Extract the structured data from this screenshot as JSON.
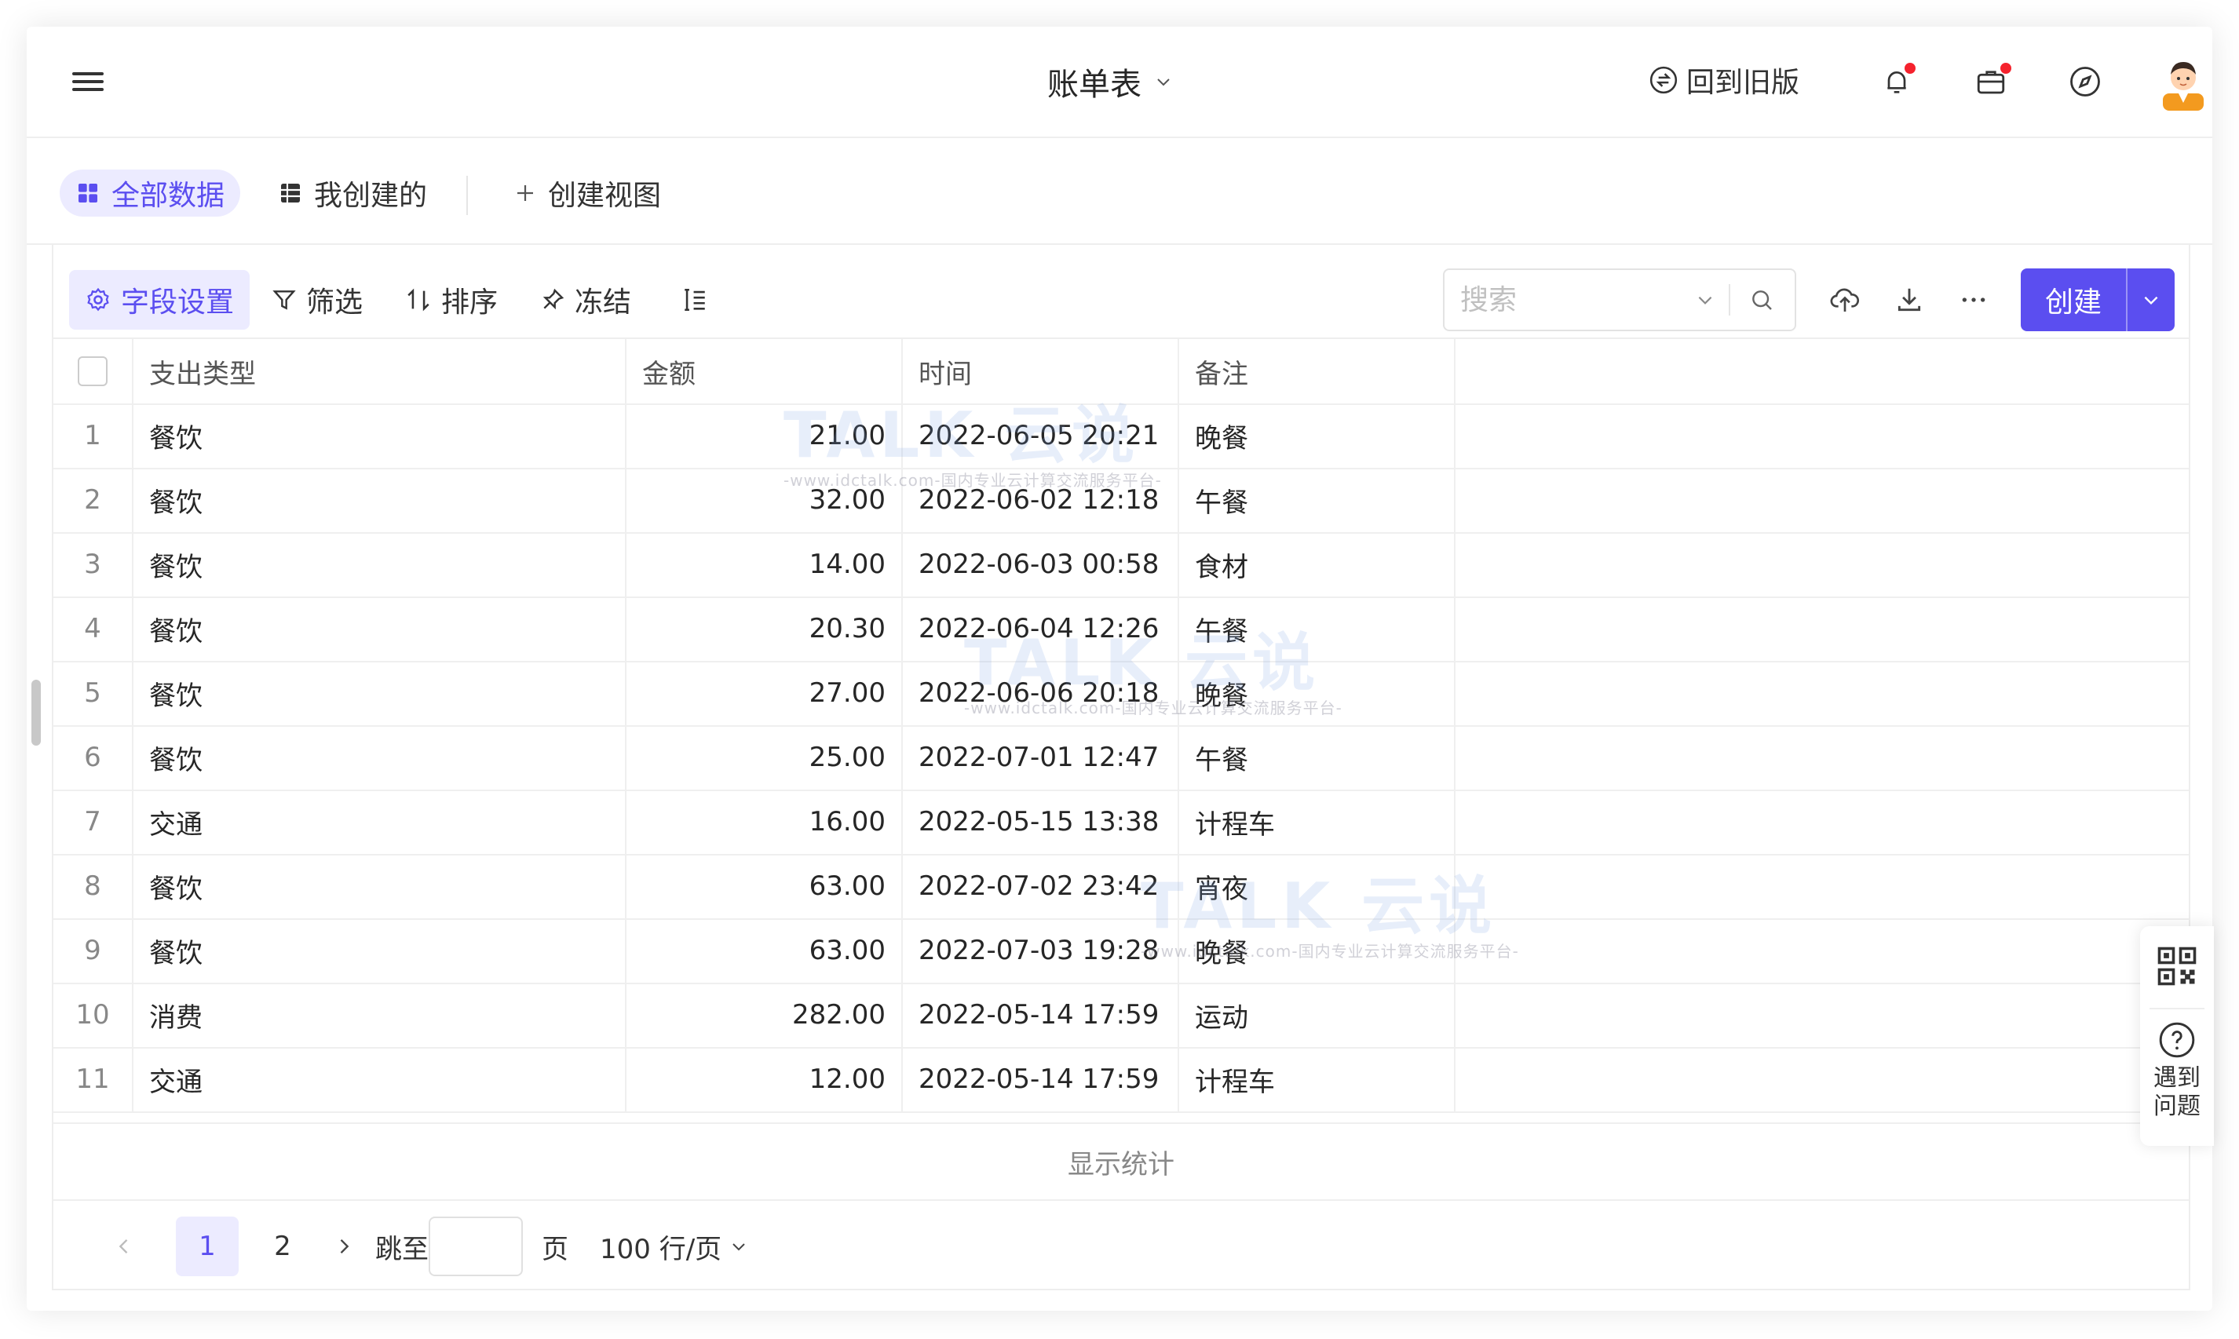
{
  "header": {
    "title": "账单表",
    "back_old_label": "回到旧版"
  },
  "view_tabs": [
    {
      "label": "全部数据",
      "active": true
    },
    {
      "label": "我创建的",
      "active": false
    },
    {
      "label": "创建视图",
      "active": false
    }
  ],
  "toolbar": {
    "field_settings": "字段设置",
    "filter": "筛选",
    "sort": "排序",
    "freeze": "冻结",
    "search_placeholder": "搜索",
    "create": "创建"
  },
  "table": {
    "columns": [
      "支出类型",
      "金额",
      "时间",
      "备注"
    ],
    "rows": [
      {
        "idx": "1",
        "type": "餐饮",
        "amount": "21.00",
        "time": "2022-06-05 20:21",
        "note": "晚餐"
      },
      {
        "idx": "2",
        "type": "餐饮",
        "amount": "32.00",
        "time": "2022-06-02 12:18",
        "note": "午餐"
      },
      {
        "idx": "3",
        "type": "餐饮",
        "amount": "14.00",
        "time": "2022-06-03 00:58",
        "note": "食材"
      },
      {
        "idx": "4",
        "type": "餐饮",
        "amount": "20.30",
        "time": "2022-06-04 12:26",
        "note": "午餐"
      },
      {
        "idx": "5",
        "type": "餐饮",
        "amount": "27.00",
        "time": "2022-06-06 20:18",
        "note": "晚餐"
      },
      {
        "idx": "6",
        "type": "餐饮",
        "amount": "25.00",
        "time": "2022-07-01 12:47",
        "note": "午餐"
      },
      {
        "idx": "7",
        "type": "交通",
        "amount": "16.00",
        "time": "2022-05-15 13:38",
        "note": "计程车"
      },
      {
        "idx": "8",
        "type": "餐饮",
        "amount": "63.00",
        "time": "2022-07-02 23:42",
        "note": "宵夜"
      },
      {
        "idx": "9",
        "type": "餐饮",
        "amount": "63.00",
        "time": "2022-07-03 19:28",
        "note": "晚餐"
      },
      {
        "idx": "10",
        "type": "消费",
        "amount": "282.00",
        "time": "2022-05-14 17:59",
        "note": "运动"
      },
      {
        "idx": "11",
        "type": "交通",
        "amount": "12.00",
        "time": "2022-05-14 17:59",
        "note": "计程车"
      }
    ],
    "stats_label": "显示统计"
  },
  "pagination": {
    "pages": [
      "1",
      "2"
    ],
    "current_page": "1",
    "jump_label": "跳至",
    "page_unit": "页",
    "page_size": "100 行/页"
  },
  "watermark": {
    "brand": "TALK 云说",
    "tagline": "-www.idctalk.com-国内专业云计算交流服务平台-"
  },
  "float_panel": {
    "help_label": "遇到问题"
  },
  "colors": {
    "accent": "#5b4ef0",
    "accent_bg": "#ecebff",
    "notification_dot": "#f5222d"
  },
  "icons": [
    "menu-icon",
    "chevron-down-icon",
    "switch-icon",
    "bell-icon",
    "briefcase-icon",
    "compass-icon",
    "avatar",
    "grid-icon",
    "table-icon",
    "plus-icon",
    "gear-icon",
    "filter-icon",
    "sort-icon",
    "pin-icon",
    "row-height-icon",
    "search-icon",
    "upload-icon",
    "download-icon",
    "more-icon",
    "qr-code-icon",
    "help-icon"
  ]
}
